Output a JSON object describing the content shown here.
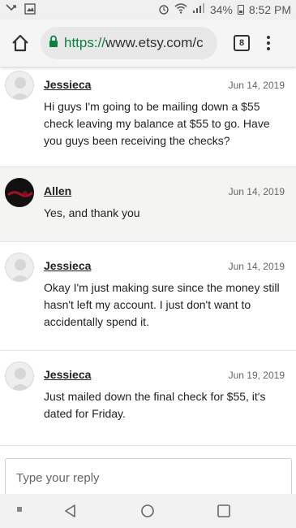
{
  "status_bar": {
    "battery": "34%",
    "time": "8:52 PM"
  },
  "browser": {
    "url_scheme": "https://",
    "url_host": "www.etsy.com/c",
    "tab_count": "8"
  },
  "messages": [
    {
      "author": "Jessieca",
      "date": "Jun 14, 2019",
      "text": "Hi guys I'm going to be mailing down a $55 check leaving my balance at $55 to go. Have you guys been receiving the checks?"
    },
    {
      "author": "Allen",
      "date": "Jun 14, 2019",
      "text": "Yes, and thank you"
    },
    {
      "author": "Jessieca",
      "date": "Jun 14, 2019",
      "text": "Okay I'm just making sure since the money still hasn't left my account. I just don't want to accidentally spend it."
    },
    {
      "author": "Jessieca",
      "date": "Jun 19, 2019",
      "text": "Just mailed down the final check for $55, it's dated for Friday."
    }
  ],
  "reply": {
    "placeholder": "Type your reply"
  },
  "colors": {
    "url_green": "#0b8043",
    "alt_row": "#f4f4f2"
  }
}
